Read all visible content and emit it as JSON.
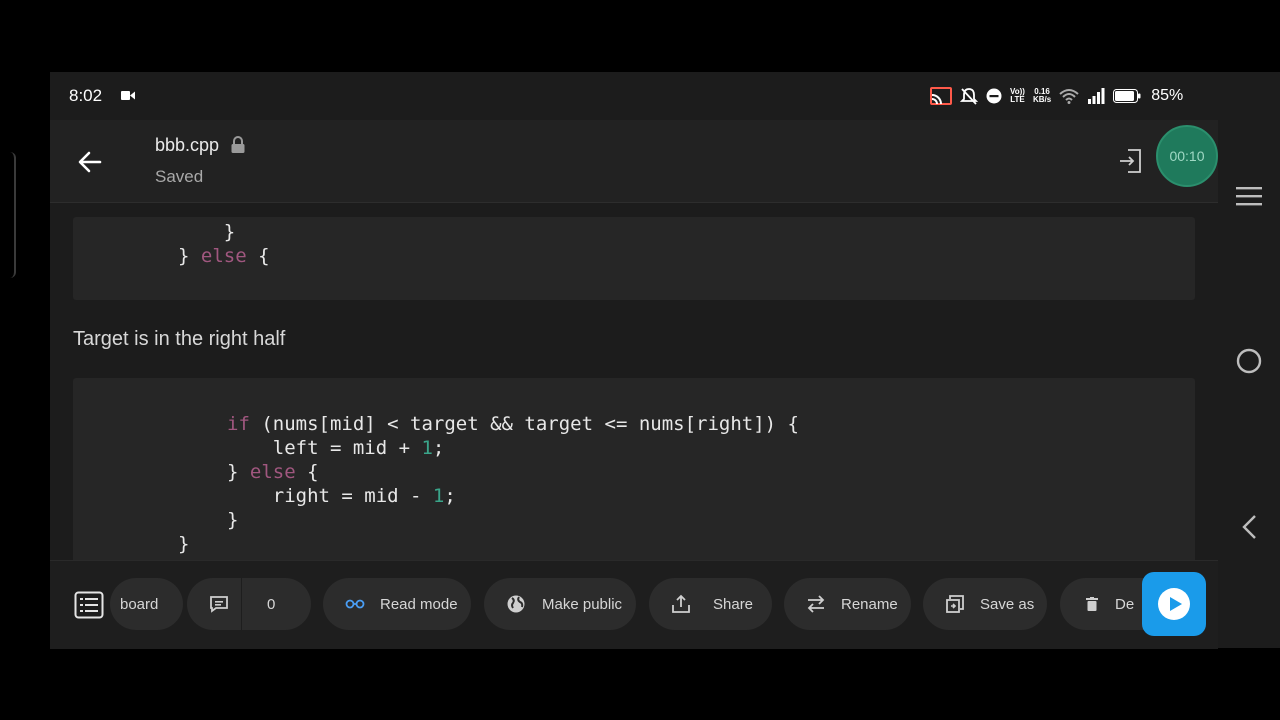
{
  "status_bar": {
    "time": "8:02",
    "net_speed_top": "0.16",
    "net_speed_bottom": "KB/s",
    "volte_top": "Vo))",
    "volte_bottom": "LTE",
    "battery": "85%"
  },
  "app_bar": {
    "file_name": "bbb.cpp",
    "save_status": "Saved",
    "timer": "00:10"
  },
  "content": {
    "block1_lines": [
      "    }",
      "} ",
      "else",
      " {"
    ],
    "paragraph": "Target is in the right half",
    "block2": {
      "if_kw": "if",
      "line1_rest": " (nums[mid] < target && target <= nums[right]) {",
      "line2_pre": "    left = mid + ",
      "line2_num": "1",
      "line2_post": ";",
      "line3_pre": "} ",
      "else_kw": "else",
      "line3_post": " {",
      "line4_pre": "    right = mid - ",
      "line4_num": "1",
      "line4_post": ";",
      "line5": "}",
      "line6": "}"
    }
  },
  "toolbar": {
    "items": [
      {
        "label": "board",
        "icon": "dashboard-icon"
      },
      {
        "label": "0",
        "icon": "comment-icon"
      },
      {
        "label": "Read mode",
        "icon": "glasses-icon"
      },
      {
        "label": "Make public",
        "icon": "globe-icon"
      },
      {
        "label": "Share",
        "icon": "share-icon"
      },
      {
        "label": "Rename",
        "icon": "swap-icon"
      },
      {
        "label": "Save as",
        "icon": "save-as-icon"
      },
      {
        "label": "De",
        "icon": "trash-icon"
      }
    ]
  },
  "colors": {
    "background": "#1c1c1c",
    "code_block": "#262626",
    "keyword": "#a0577f",
    "number": "#3aa58a",
    "fab": "#1a9bea",
    "timer": "#1f7a5c"
  }
}
